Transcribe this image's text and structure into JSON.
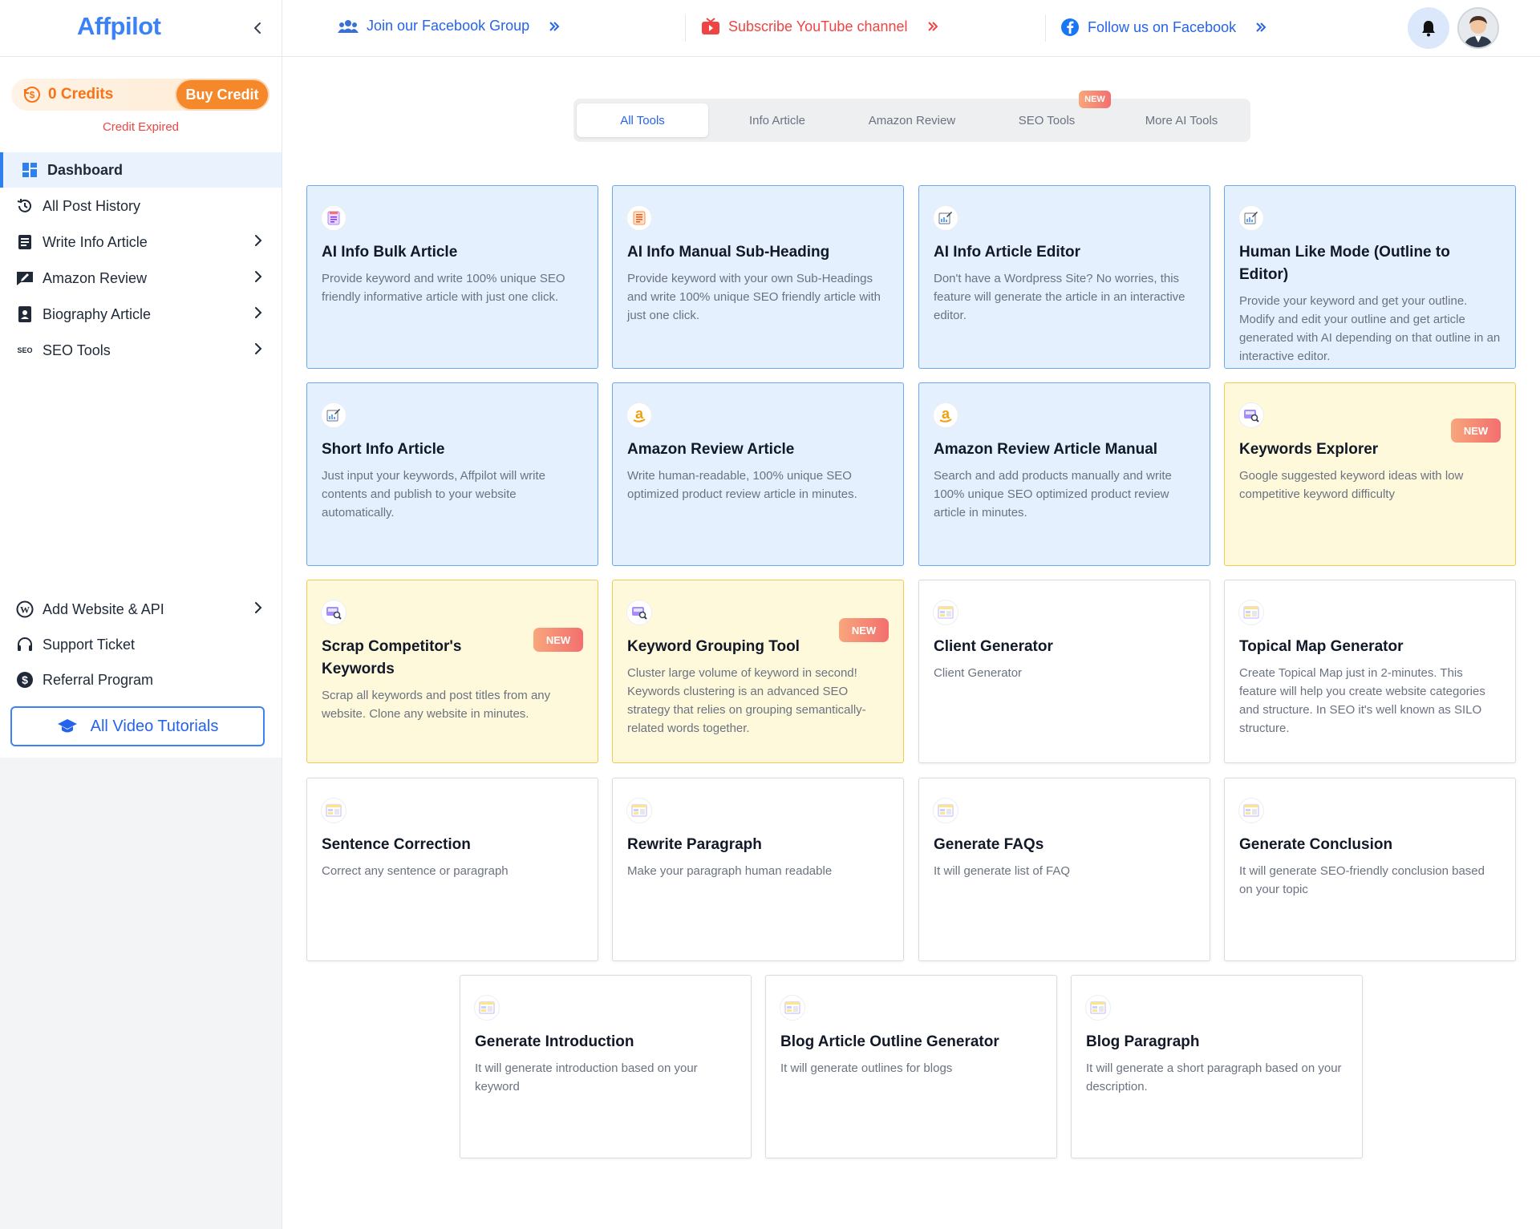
{
  "app": {
    "logo_text": "Affpilot",
    "accent_color": "#3b82f6",
    "orange_color": "#f5882a"
  },
  "sidebar": {
    "credits_label": "0 Credits",
    "buy_credit_label": "Buy Credit",
    "credit_status": "Credit Expired",
    "nav": [
      {
        "label": "Dashboard",
        "icon": "grid-icon",
        "active": true
      },
      {
        "label": "All Post History",
        "icon": "history-icon"
      },
      {
        "label": "Write Info Article",
        "icon": "document-icon",
        "chevron": true
      },
      {
        "label": "Amazon Review",
        "icon": "review-icon",
        "chevron": true
      },
      {
        "label": "Biography Article",
        "icon": "biography-icon",
        "chevron": true
      },
      {
        "label": "SEO Tools",
        "icon": "seo-icon",
        "icon_text": "SEO",
        "chevron": true
      }
    ],
    "bottom_nav": [
      {
        "label": "Add Website & API",
        "icon": "wordpress-icon",
        "chevron": true
      },
      {
        "label": "Support Ticket",
        "icon": "headset-icon"
      },
      {
        "label": "Referral Program",
        "icon": "dollar-icon"
      }
    ],
    "tutorials_label": "All Video Tutorials"
  },
  "topbar": {
    "facebook_group": "Join our Facebook Group",
    "youtube": "Subscribe YouTube channel",
    "facebook_follow": "Follow us on Facebook"
  },
  "tabs": {
    "items": [
      "All Tools",
      "Info Article",
      "Amazon Review",
      "SEO Tools",
      "More AI Tools"
    ],
    "active": "All Tools",
    "new_badge": "NEW"
  },
  "cards": [
    {
      "title": "AI Info Bulk Article",
      "desc": "Provide keyword and write 100% unique SEO friendly informative article with just one click.",
      "style": "blue",
      "icon": "document-icon"
    },
    {
      "title": "AI Info Manual Sub-Heading",
      "desc": "Provide keyword with your own Sub-Headings and write 100% unique SEO friendly article with just one click.",
      "style": "blue",
      "icon": "document-icon"
    },
    {
      "title": "AI Info Article Editor",
      "desc": "Don't have a Wordpress Site? No worries, this feature will generate the article in an interactive editor.",
      "style": "blue",
      "icon": "edit-icon"
    },
    {
      "title": "Human Like Mode (Outline to Editor)",
      "desc": "Provide your keyword and get your outline. Modify and edit your outline and get article generated with AI depending on that outline in an interactive editor.",
      "style": "blue",
      "icon": "edit-icon"
    },
    {
      "title": "Short Info Article",
      "desc": "Just input your keywords, Affpilot will write contents and publish to your website automatically.",
      "style": "blue",
      "icon": "edit-icon"
    },
    {
      "title": "Amazon Review Article",
      "desc": "Write human-readable, 100% unique SEO optimized product review article in minutes.",
      "style": "blue",
      "icon": "amazon-icon"
    },
    {
      "title": "Amazon Review Article Manual",
      "desc": "Search and add products manually and write 100% unique SEO optimized product review article in minutes.",
      "style": "blue",
      "icon": "amazon-icon"
    },
    {
      "title": "Keywords Explorer",
      "desc": "Google suggested keyword ideas with low competitive keyword difficulty",
      "style": "yellow",
      "icon": "seo-search-icon",
      "badge": "NEW"
    },
    {
      "title": "Scrap Competitor's Keywords",
      "desc": "Scrap all keywords and post titles from any website. Clone any website in minutes.",
      "style": "yellow",
      "icon": "seo-search-icon",
      "badge": "NEW"
    },
    {
      "title": "Keyword Grouping Tool",
      "desc": "Cluster large volume of keyword in second! Keywords clustering is an advanced SEO strategy that relies on grouping semantically-related words together.",
      "style": "yellow",
      "icon": "seo-search-icon",
      "badge": "NEW"
    },
    {
      "title": "Client Generator",
      "desc": "Client Generator",
      "style": "white",
      "icon": "layout-icon"
    },
    {
      "title": "Topical Map Generator",
      "desc": "Create Topical Map just in 2-minutes. This feature will help you create website categories and structure. In SEO it's well known as SILO structure.",
      "style": "white",
      "icon": "layout-icon"
    },
    {
      "title": "Sentence Correction",
      "desc": "Correct any sentence or paragraph",
      "style": "white",
      "icon": "layout-icon"
    },
    {
      "title": "Rewrite Paragraph",
      "desc": "Make your paragraph human readable",
      "style": "white",
      "icon": "layout-icon"
    },
    {
      "title": "Generate FAQs",
      "desc": "It will generate list of FAQ",
      "style": "white",
      "icon": "layout-icon"
    },
    {
      "title": "Generate Conclusion",
      "desc": "It will generate SEO-friendly conclusion based on your topic",
      "style": "white",
      "icon": "layout-icon"
    },
    {
      "title": "Generate Introduction",
      "desc": "It will generate introduction based on your keyword",
      "style": "white",
      "icon": "layout-icon"
    },
    {
      "title": "Blog Article Outline Generator",
      "desc": "It will generate outlines for blogs",
      "style": "white",
      "icon": "layout-icon"
    },
    {
      "title": "Blog Paragraph",
      "desc": "It will generate a short paragraph based on your description.",
      "style": "white",
      "icon": "layout-icon"
    }
  ]
}
